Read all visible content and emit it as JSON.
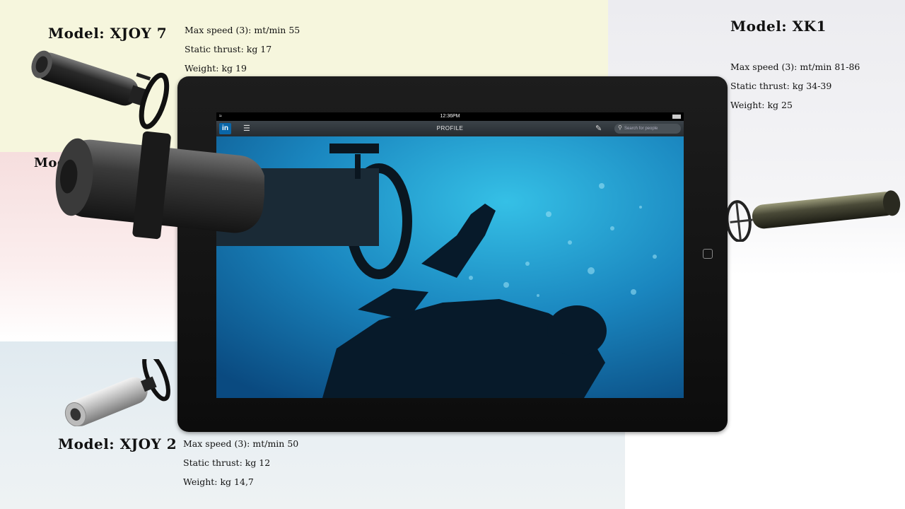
{
  "models": {
    "xjoy7": {
      "title": "Model: XJOY 7",
      "specs": [
        "Max speed (3): mt/min 55",
        "Static thrust: kg 17",
        "Weight: kg 19"
      ]
    },
    "xk1": {
      "title": "Model: XK1",
      "specs": [
        "Max speed (3): mt/min 81-86",
        "Static thrust: kg 34-39",
        "Weight: kg 25"
      ]
    },
    "xjoy2": {
      "title": "Model: XJOY 2",
      "specs": [
        "Max speed (3): mt/min 50",
        "Static thrust: kg 12",
        "Weight: kg 14,7"
      ]
    },
    "partial": {
      "title": "Mod"
    }
  },
  "tablet": {
    "status_time": "12:36PM",
    "logo": "in",
    "nav_title": "PROFILE",
    "search_placeholder": "Search for people",
    "icons": {
      "menu": "list-icon",
      "compose": "compose-icon",
      "search": "search-icon",
      "wifi": "wifi-icon",
      "battery": "battery-icon"
    }
  },
  "colors": {
    "linkedin_blue": "#0a66a8",
    "water_top": "#1a9fcf",
    "water_bottom": "#0a4f86"
  }
}
